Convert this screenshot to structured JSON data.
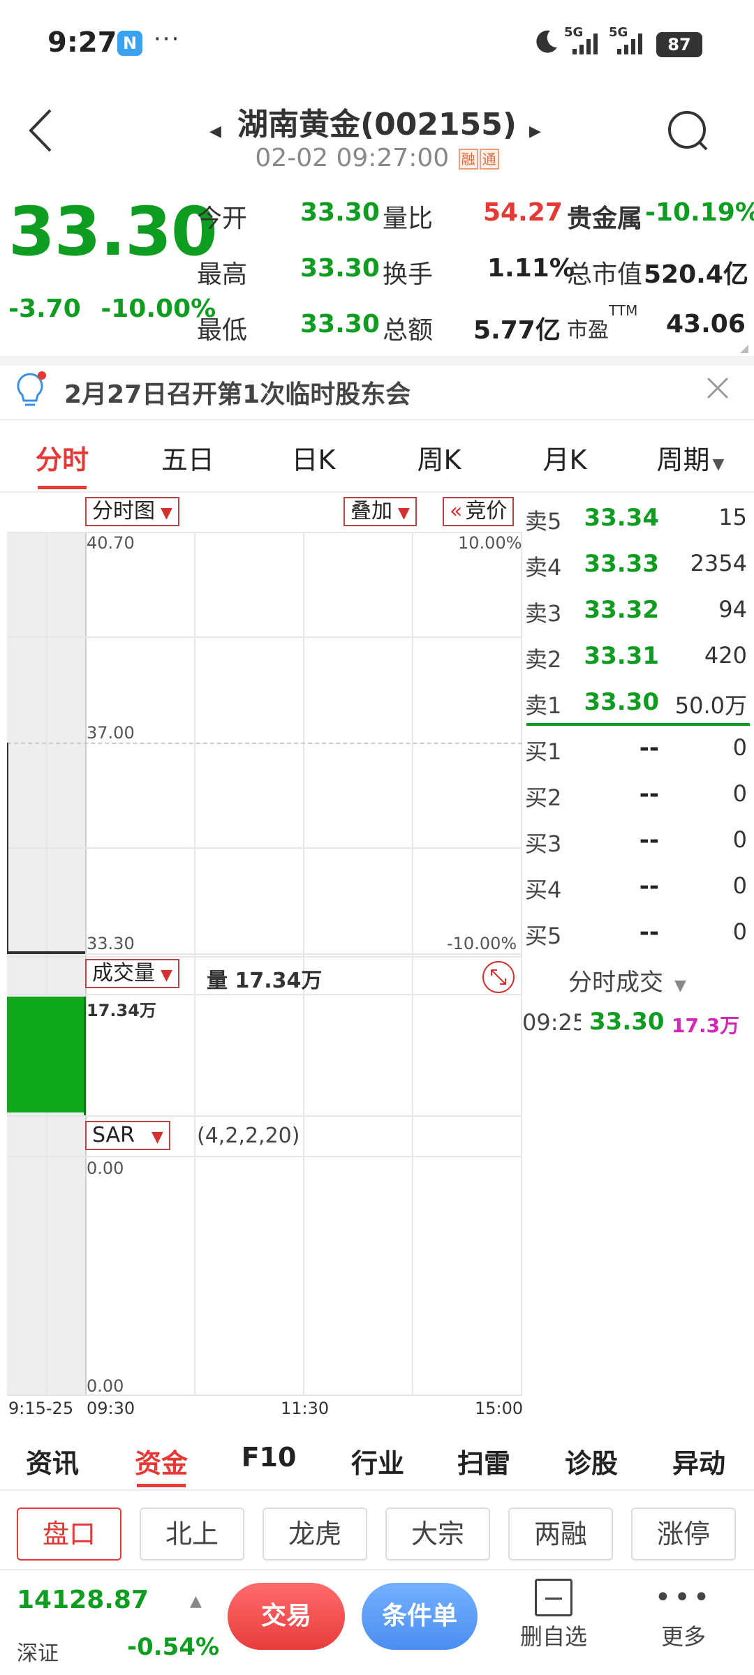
{
  "status": {
    "time": "9:27",
    "nfc": "N",
    "more": "···",
    "network": "5G",
    "battery": "87"
  },
  "header": {
    "title": "湖南黄金(002155)",
    "datetime": "02-02 09:27:00",
    "tag1": "融",
    "tag2": "通"
  },
  "quote": {
    "price": "33.30",
    "change": "-3.70",
    "change_pct": "-10.00%",
    "rows": [
      {
        "l1": "今开",
        "v1": "33.30",
        "l2": "量比",
        "v2": "54.27",
        "l3": "贵金属",
        "v3": "-10.19%"
      },
      {
        "l1": "最高",
        "v1": "33.30",
        "l2": "换手",
        "v2": "1.11%",
        "l3": "总市值",
        "v3": "520.4亿"
      },
      {
        "l1": "最低",
        "v1": "33.30",
        "l2": "总额",
        "v2": "5.77亿",
        "l3": "市盈",
        "l3sup": "TTM",
        "v3": "43.06"
      }
    ]
  },
  "notice": {
    "text": "2月27日召开第1次临时股东会"
  },
  "tabs": [
    "分时",
    "五日",
    "日K",
    "周K",
    "月K",
    "周期"
  ],
  "chart": {
    "dropdown_main": "分时图",
    "dropdown_overlay": "叠加",
    "auction": "竞价",
    "price_high": "40.70",
    "price_mid": "37.00",
    "price_low": "33.30",
    "pct_high": "10.00%",
    "pct_low": "-10.00%",
    "volume_dropdown": "成交量",
    "volume_text": "量 17.34万",
    "volume_axis": "17.34万",
    "sar_dropdown": "SAR",
    "sar_params": "(4,2,2,20)",
    "sar_high": "0.00",
    "sar_low": "0.00",
    "time_labels": [
      "9:15-25",
      "09:30",
      "11:30",
      "15:00"
    ]
  },
  "orderbook": {
    "asks": [
      {
        "label": "卖5",
        "price": "33.34",
        "vol": "15"
      },
      {
        "label": "卖4",
        "price": "33.33",
        "vol": "2354"
      },
      {
        "label": "卖3",
        "price": "33.32",
        "vol": "94"
      },
      {
        "label": "卖2",
        "price": "33.31",
        "vol": "420"
      },
      {
        "label": "卖1",
        "price": "33.30",
        "vol": "50.0万"
      }
    ],
    "bids": [
      {
        "label": "买1",
        "price": "--",
        "vol": "0"
      },
      {
        "label": "买2",
        "price": "--",
        "vol": "0"
      },
      {
        "label": "买3",
        "price": "--",
        "vol": "0"
      },
      {
        "label": "买4",
        "price": "--",
        "vol": "0"
      },
      {
        "label": "买5",
        "price": "--",
        "vol": "0"
      }
    ],
    "ticks_title": "分时成交",
    "tick": {
      "time": "09:25",
      "price": "33.30",
      "vol": "17.3万"
    }
  },
  "bottom_tabs": [
    "资讯",
    "资金",
    "F10",
    "行业",
    "扫雷",
    "诊股",
    "异动"
  ],
  "chips": [
    "盘口",
    "北上",
    "龙虎",
    "大宗",
    "两融",
    "涨停"
  ],
  "footer": {
    "index_value": "14128.87",
    "index_name": "深证",
    "index_change": "-0.54%",
    "trade": "交易",
    "condition": "条件单",
    "remove": "删自选",
    "more": "更多"
  },
  "colors": {
    "up": "#e53935",
    "down": "#0f9d21",
    "accent": "#e53935",
    "trade_btn": "#f0484a",
    "cond_btn": "#5a9cf0"
  }
}
